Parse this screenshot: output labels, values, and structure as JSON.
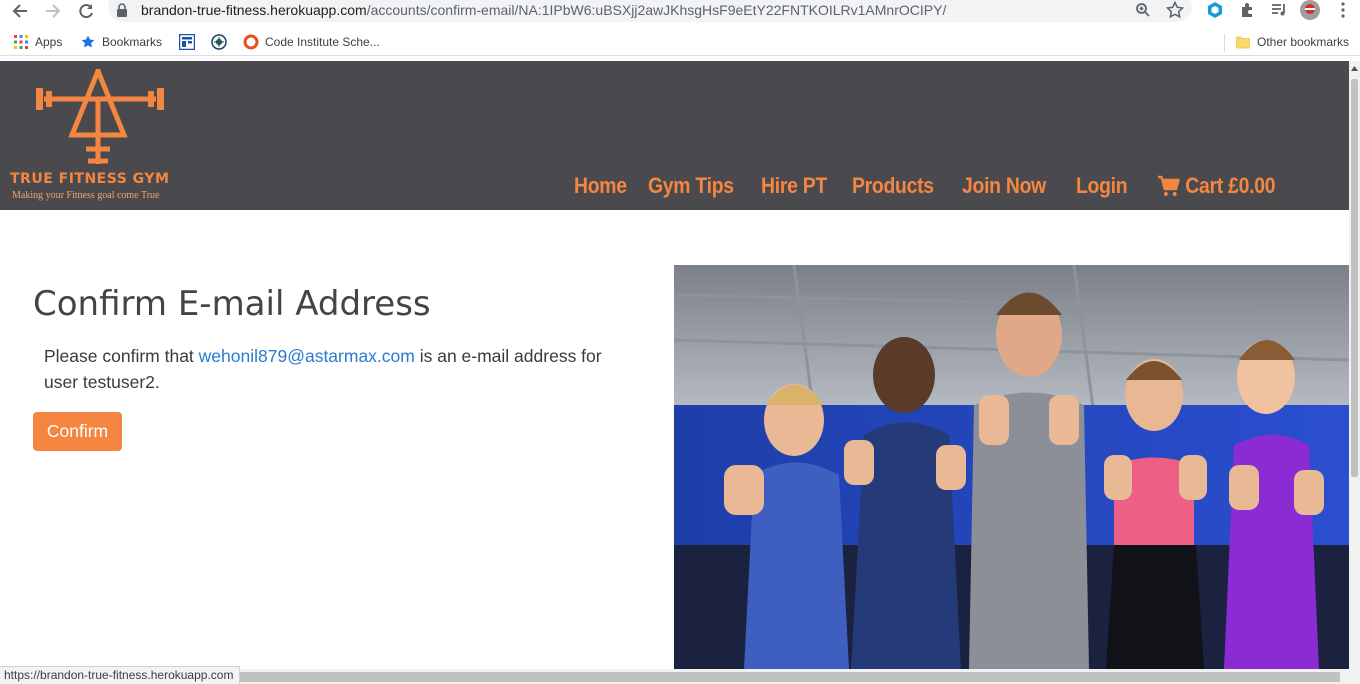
{
  "browser": {
    "url_host": "brandon-true-fitness.herokuapp.com",
    "url_path": "/accounts/confirm-email/NA:1IPbW6:uBSXjj2awJKhsgHsF9eEtY22FNTKOILRv1AMnrOCIPY/",
    "bookmarks": [
      {
        "label": "Apps",
        "icon": "apps-grid-icon"
      },
      {
        "label": "Bookmarks",
        "icon": "star-icon"
      },
      {
        "label": "",
        "icon": "bookmark-site-icon"
      },
      {
        "label": "",
        "icon": "bookmark-globe-icon"
      },
      {
        "label": "Code Institute Sche...",
        "icon": "code-institute-icon"
      }
    ],
    "other_bookmarks": "Other bookmarks",
    "status_url": "https://brandon-true-fitness.herokuapp.com"
  },
  "site": {
    "logo_title": "TRUE FITNESS GYM",
    "logo_tagline": "Making your Fitness goal come True",
    "nav": [
      "Home",
      "Gym Tips",
      "Hire PT",
      "Products",
      "Join Now",
      "Login"
    ],
    "cart_label": "Cart £0.00",
    "accent_color": "#f48641",
    "header_color": "#4a4a4e"
  },
  "main": {
    "title": "Confirm E-mail Address",
    "msg_prefix": "Please confirm that ",
    "email": "wehonil879@astarmax.com",
    "msg_suffix": " is an e-mail address for user testuser2.",
    "confirm_label": "Confirm"
  }
}
